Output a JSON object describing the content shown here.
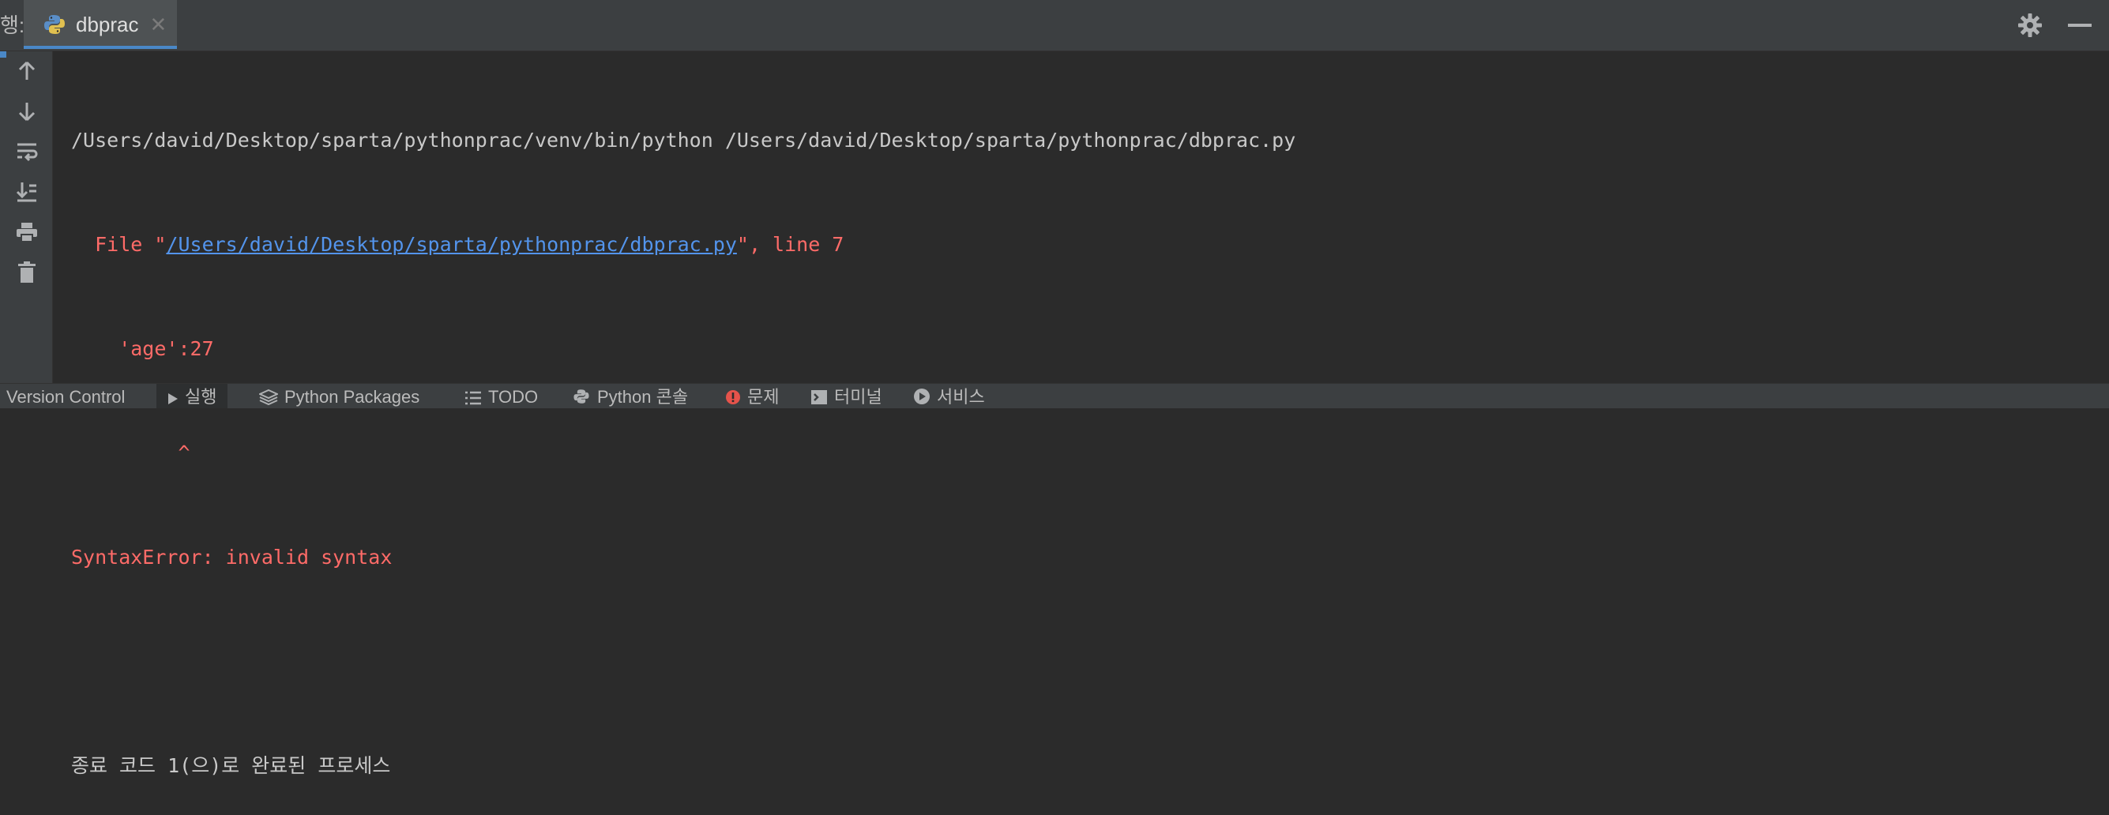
{
  "tab_bar": {
    "run_label": "행:",
    "tab_label": "dbprac",
    "close_glyph": "✕",
    "icons": [
      "python-file-icon",
      "gear-icon",
      "minimize-icon"
    ]
  },
  "left_toolbar": {
    "buttons": [
      "arrow-up-icon",
      "arrow-down-icon",
      "soft-wrap-icon",
      "scroll-to-end-icon",
      "print-icon",
      "trash-icon"
    ]
  },
  "console": {
    "command": "/Users/david/Desktop/sparta/pythonprac/venv/bin/python /Users/david/Desktop/sparta/pythonprac/dbprac.py",
    "file_prefix": "  File \"",
    "file_link": "/Users/david/Desktop/sparta/pythonprac/dbprac.py",
    "file_suffix": "\", line 7",
    "code_line": "    'age':27",
    "caret_line": "         ^",
    "error": "SyntaxError: invalid syntax",
    "exit_message": "종료 코드 1(으)로 완료된 프로세스"
  },
  "bottom_bar": {
    "items": [
      {
        "label": "Version Control"
      },
      {
        "label": "실행"
      },
      {
        "label": "Python Packages"
      },
      {
        "label": "TODO"
      },
      {
        "label": "Python 콘솔"
      },
      {
        "label": "문제"
      },
      {
        "label": "터미널"
      },
      {
        "label": "서비스"
      }
    ],
    "colors": {
      "problems_icon": "#e5534b",
      "accent": "#4a88c7"
    }
  }
}
